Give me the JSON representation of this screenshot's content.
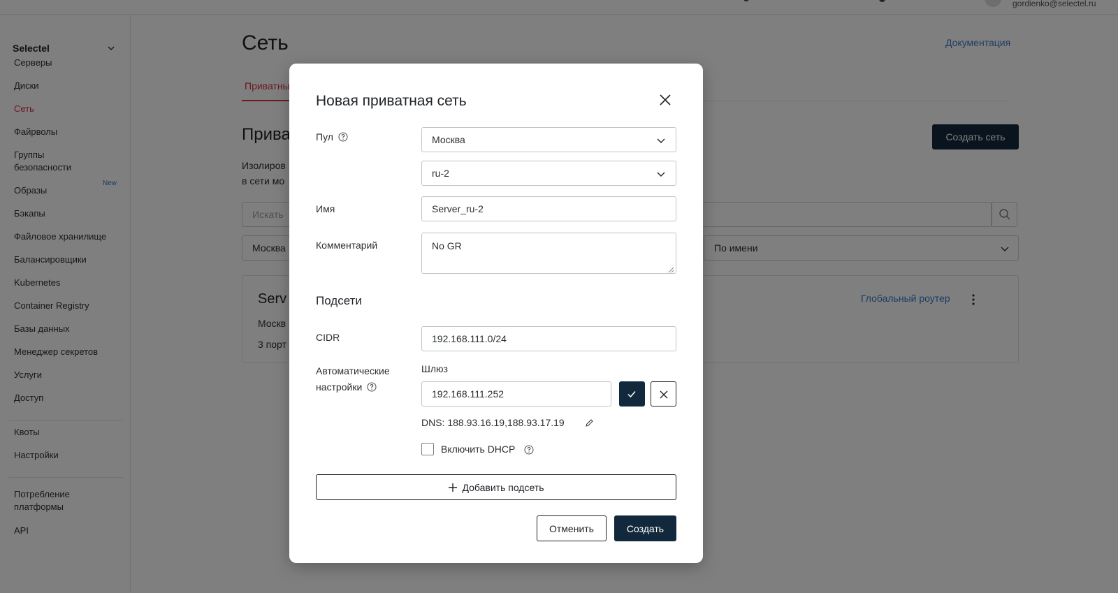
{
  "topbar": {
    "user_email": "gordienko@selectel.ru"
  },
  "sidebar": {
    "project": "Selectel",
    "items": [
      {
        "label": "Серверы"
      },
      {
        "label": "Диски"
      },
      {
        "label": "Сеть"
      },
      {
        "label": "Файрволы"
      },
      {
        "label": "Группы\nбезопасности"
      },
      {
        "label": "Образы"
      },
      {
        "label": "Бэкапы"
      },
      {
        "label": "Файловое хранилище"
      },
      {
        "label": "Балансировщики"
      },
      {
        "label": "Kubernetes"
      },
      {
        "label": "Container Registry"
      },
      {
        "label": "Базы данных"
      },
      {
        "label": "Менеджер секретов"
      },
      {
        "label": "Услуги"
      },
      {
        "label": "Доступ"
      },
      {
        "label": "Квоты"
      },
      {
        "label": "Настройки"
      },
      {
        "label": "Потребление\nплатформы"
      },
      {
        "label": "API"
      }
    ],
    "new_badge": "New",
    "active_item": "Сеть"
  },
  "page": {
    "title": "Сеть",
    "doc_link": "Документация",
    "active_tab": "Приватны",
    "section_title": "Прива",
    "section_desc": "Изолиров\nв сети мо",
    "create_network_button": "Создать сеть",
    "search_placeholder": "Искать",
    "filter_region": "Москва",
    "sort_value": "По имени",
    "card": {
      "title": "Serv",
      "region": "Москв",
      "ports": "3 порт",
      "global_router": "Глобальный роутер"
    }
  },
  "modal": {
    "title": "Новая приватная сеть",
    "pool_label": "Пул",
    "pool_value": "Москва",
    "zone_value": "ru-2",
    "name_label": "Имя",
    "name_value": "Server_ru-2",
    "comment_label": "Комментарий",
    "comment_value": "No GR",
    "subnets_heading": "Подсети",
    "cidr_label": "CIDR",
    "cidr_value": "192.168.111.0/24",
    "auto_settings_label_line1": "Автоматические",
    "auto_settings_label_line2": "настройки",
    "gateway_label": "Шлюз",
    "gateway_value": "192.168.111.252",
    "dns_text": "DNS: 188.93.16.19,188.93.17.19",
    "dhcp_label": "Включить DHCP",
    "dhcp_checked": false,
    "add_subnet_button": "Добавить подсеть",
    "cancel_button": "Отменить",
    "create_button": "Создать"
  },
  "colors": {
    "accent_red": "#d9333f",
    "primary_dark": "#12293d",
    "link_blue": "#3b78c9"
  }
}
